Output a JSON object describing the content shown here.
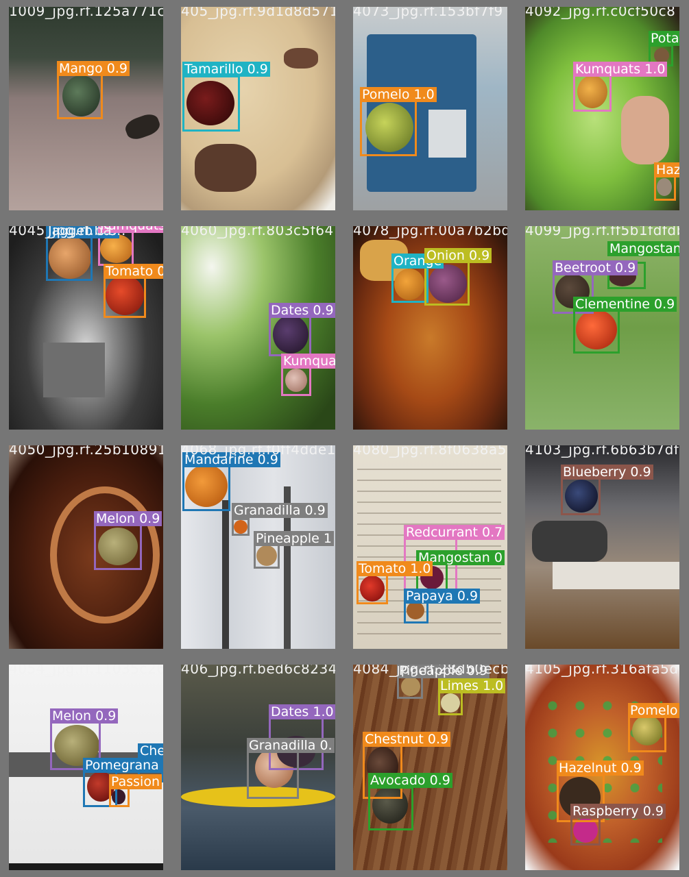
{
  "tiles": [
    {
      "file": "1009_jpg.rf.125a771c",
      "dets": [
        {
          "label": "Mango 0.9",
          "color": "#f08a1c"
        }
      ]
    },
    {
      "file": "405_jpg.rf.9d1d8d571",
      "dets": [
        {
          "label": "Tamarillo 0.9",
          "color": "#1fb3c4"
        }
      ]
    },
    {
      "file": "4073_jpg.rf.153bf7f9",
      "dets": [
        {
          "label": "Pomelo 1.0",
          "color": "#f08a1c"
        }
      ]
    },
    {
      "file": "4092_jpg.rf.c0cf50c8",
      "dets": [
        {
          "label": "Potat",
          "color": "#2ca02c"
        },
        {
          "label": "Kumquats 1.0",
          "color": "#e377c2"
        },
        {
          "label": "Haze",
          "color": "#f08a1c"
        }
      ]
    },
    {
      "file": "4045_jpg.rf.ba...",
      "dets": [
        {
          "label": "Jaggeb 0.9",
          "color": "#1f77b4"
        },
        {
          "label": "Kumquats",
          "color": "#e377c2"
        },
        {
          "label": "Tomato 0",
          "color": "#f08a1c"
        }
      ]
    },
    {
      "file": "4060_jpg.rf.803c5f64",
      "dets": [
        {
          "label": "Dates 0.9",
          "color": "#9467bd"
        },
        {
          "label": "Kumqua",
          "color": "#e377c2"
        }
      ]
    },
    {
      "file": "4078_jpg.rf.00a7b2bd",
      "dets": [
        {
          "label": "Orange",
          "color": "#1fb3c4"
        },
        {
          "label": "Onion 0.9",
          "color": "#bcbd22"
        }
      ]
    },
    {
      "file": "4099_jpg.rf.ff5b1fdfdb",
      "dets": [
        {
          "label": "Mangostan",
          "color": "#2ca02c"
        },
        {
          "label": "Beetroot 0.9",
          "color": "#9467bd"
        },
        {
          "label": "Clementine 0.9",
          "color": "#2ca02c"
        }
      ]
    },
    {
      "file": "4050_jpg.rf.25b10891",
      "dets": [
        {
          "label": "Melon 0.9",
          "color": "#9467bd"
        }
      ]
    },
    {
      "file": "4068_jpg.rf.f0ff4dde1",
      "dets": [
        {
          "label": "Mandarine 0.9",
          "color": "#1f77b4"
        },
        {
          "label": "Granadilla 0.9",
          "color": "#7f7f7f"
        },
        {
          "label": "Pineapple 1",
          "color": "#7f7f7f"
        }
      ]
    },
    {
      "file": "4080_jpg.rf.8f0638a5",
      "dets": [
        {
          "label": "Redcurrant 0.7",
          "color": "#e377c2"
        },
        {
          "label": "Mangostan 0",
          "color": "#2ca02c"
        },
        {
          "label": "Tomato 1.0",
          "color": "#f08a1c"
        },
        {
          "label": "Papaya 0.9",
          "color": "#1f77b4"
        }
      ]
    },
    {
      "file": "4103_jpg.rf.6b63b7df8",
      "dets": [
        {
          "label": "Blueberry 0.9",
          "color": "#8c564b"
        }
      ]
    },
    {
      "file": "4054_jpg.rf.11035c26",
      "dets": [
        {
          "label": "Melon 0.9",
          "color": "#9467bd"
        },
        {
          "label": "Cher",
          "color": "#1f77b4"
        },
        {
          "label": "Pomegrana",
          "color": "#1f77b4"
        },
        {
          "label": "Passion",
          "color": "#f08a1c"
        }
      ]
    },
    {
      "file": "406_jpg.rf.bed6c8234",
      "dets": [
        {
          "label": "Dates 1.0",
          "color": "#9467bd"
        },
        {
          "label": "Granadilla 0.",
          "color": "#7f7f7f"
        }
      ]
    },
    {
      "file": "4084_jpg.rf.28d50ecb",
      "dets": [
        {
          "label": "Pineapple 0.9",
          "color": "#7f7f7f"
        },
        {
          "label": "Limes 1.0",
          "color": "#bcbd22"
        },
        {
          "label": "Chestnut 0.9",
          "color": "#f08a1c"
        },
        {
          "label": "Avocado 0.9",
          "color": "#2ca02c"
        }
      ]
    },
    {
      "file": "4105_jpg.rf.316afa5d",
      "dets": [
        {
          "label": "Pomelo",
          "color": "#f08a1c"
        },
        {
          "label": "Hazelnut 0.9",
          "color": "#f08a1c"
        },
        {
          "label": "Raspberry 0.9",
          "color": "#8c564b"
        }
      ]
    }
  ]
}
